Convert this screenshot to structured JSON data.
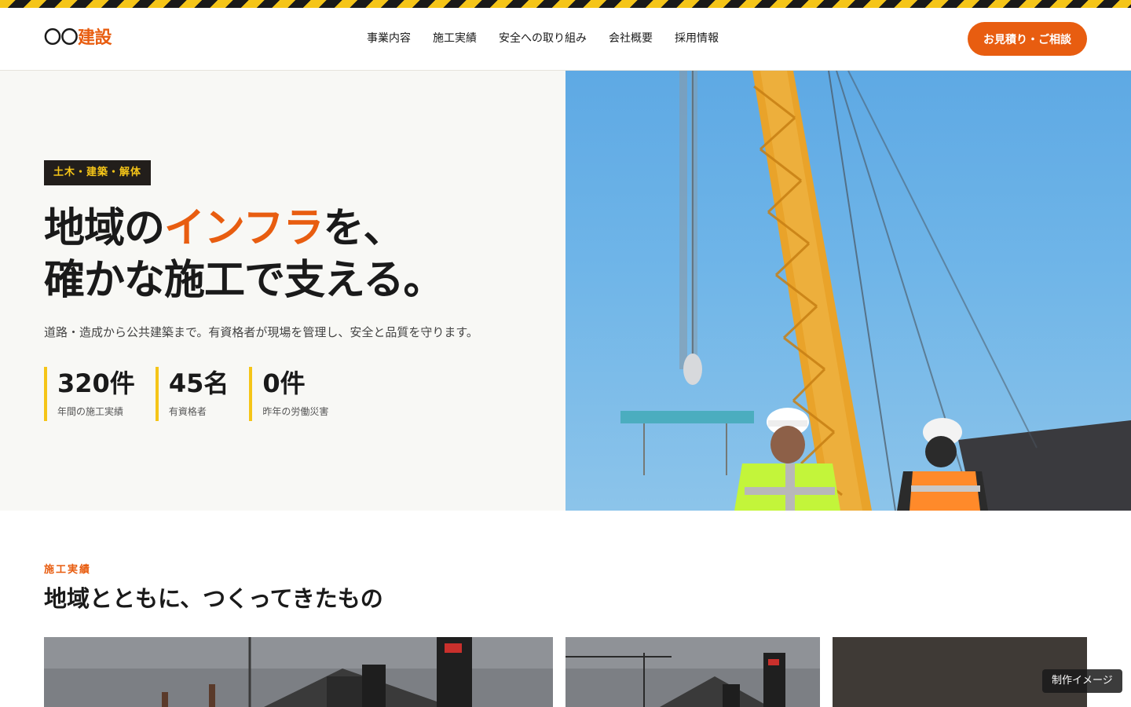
{
  "header": {
    "logo_circles": "〇〇",
    "logo_kanji": "建設",
    "nav": [
      "事業内容",
      "施工実績",
      "安全への取り組み",
      "会社概要",
      "採用情報"
    ],
    "cta_label": "お見積り・ご相談"
  },
  "hero": {
    "tag": "土木・建築・解体",
    "headline_line1_prefix": "地域の",
    "headline_line1_accent": "インフラ",
    "headline_line1_suffix": "を、",
    "headline_line2": "確かな施工で支える。",
    "lead": "道路・造成から公共建築まで。有資格者が現場を管理し、安全と品質を守ります。",
    "stats": [
      {
        "value": "320件",
        "label": "年間の施工実績"
      },
      {
        "value": "45名",
        "label": "有資格者"
      },
      {
        "value": "0件",
        "label": "昨年の労働災害"
      }
    ]
  },
  "works": {
    "eyebrow": "施工実績",
    "title": "地域とともに、つくってきたもの"
  },
  "badge": "制作イメージ",
  "colors": {
    "accent": "#e85d10",
    "hazard_yellow": "#f5c518",
    "dark": "#221e1b",
    "hero_bg": "#f8f8f5"
  }
}
